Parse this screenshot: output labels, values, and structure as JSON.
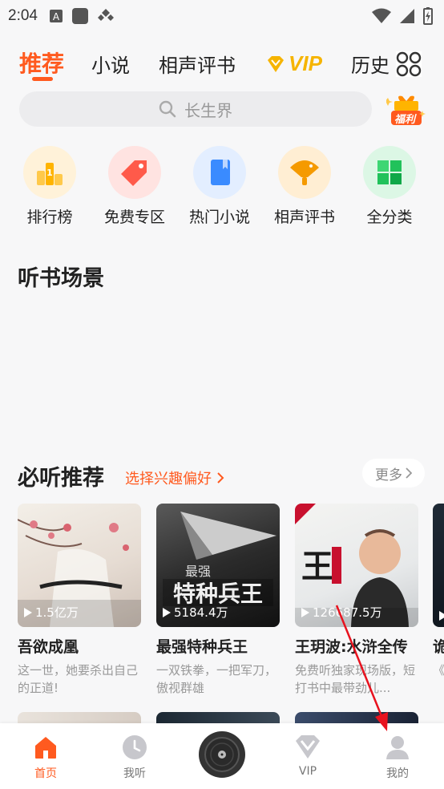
{
  "status_bar": {
    "time": "2:04"
  },
  "tabs": [
    {
      "label": "推荐"
    },
    {
      "label": "小说"
    },
    {
      "label": "相声评书"
    },
    {
      "label": "VIP"
    },
    {
      "label": "历史"
    }
  ],
  "search": {
    "placeholder": "长生界"
  },
  "welfare": {
    "label": "福利"
  },
  "categories": [
    {
      "label": "排行榜",
      "color": "#ffb400"
    },
    {
      "label": "免费专区",
      "color": "#ff5a4a"
    },
    {
      "label": "热门小说",
      "color": "#3a8bff"
    },
    {
      "label": "相声评书",
      "color": "#f59a00"
    },
    {
      "label": "全分类",
      "color": "#21c25b"
    }
  ],
  "sections": {
    "scene_title": "听书场景",
    "recommend_title": "必听推荐",
    "preference_link": "选择兴趣偏好",
    "more_label": "更多"
  },
  "books": [
    {
      "title": "吾欲成凰",
      "plays": "1.5亿万",
      "desc": "这一世，她要杀出自己的正道!"
    },
    {
      "title": "最强特种兵王",
      "plays": "5184.4万",
      "desc": "一双铁拳，一把军刀，傲视群雄"
    },
    {
      "title": "王玥波:水浒全传",
      "plays": "126687.5万",
      "desc": "免费听独家现场版，短打书中最带劲儿..."
    },
    {
      "title": "诡",
      "plays": "",
      "desc": "《传"
    }
  ],
  "bottom_nav": [
    {
      "label": "首页"
    },
    {
      "label": "我听"
    },
    {
      "label": "VIP"
    },
    {
      "label": "我的"
    }
  ],
  "colors": {
    "accent": "#ff5a1f",
    "vip_gold": "#f6b400"
  }
}
